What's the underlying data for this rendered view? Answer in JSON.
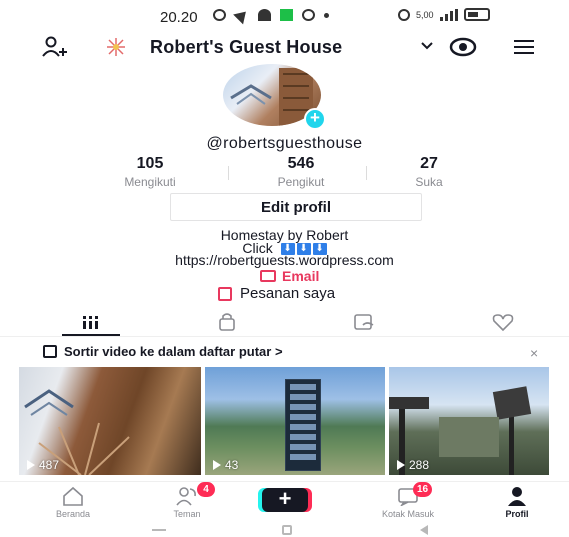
{
  "status_bar": {
    "time": "20.20",
    "network_speed": "5,00",
    "battery": "77"
  },
  "header": {
    "profile_name": "Robert's Guest House",
    "icons": [
      "add-user-icon",
      "logo-icon",
      "chevron-down-icon",
      "eye-icon",
      "menu-icon"
    ]
  },
  "profile": {
    "username": "@robertsguesthouse",
    "stats": [
      {
        "value": "105",
        "label": "Mengikuti"
      },
      {
        "value": "546",
        "label": "Pengikut"
      },
      {
        "value": "27",
        "label": "Suka"
      }
    ],
    "edit_label": "Edit profil",
    "bio_line1": "Homestay by Robert",
    "bio_line2": "Click",
    "bio_link": "https://robertguests.wordpress.com",
    "email_label": "Email",
    "orders_label": "Pesanan saya"
  },
  "playlist_bar": {
    "text": "Sortir video ke dalam daftar putar >",
    "close": "×"
  },
  "videos": [
    {
      "views": "487"
    },
    {
      "views": "43"
    },
    {
      "views": "288"
    }
  ],
  "bottom_nav": {
    "home": "Beranda",
    "friends": "Teman",
    "friends_badge": "4",
    "create": "+",
    "inbox": "Kotak Masuk",
    "inbox_badge": "16",
    "profile": "Profil"
  },
  "colors": {
    "accent_red": "#fe2c55",
    "accent_cyan": "#20d5ec",
    "link_red": "#e8385e",
    "text": "#161823",
    "muted": "#8a8b91"
  }
}
